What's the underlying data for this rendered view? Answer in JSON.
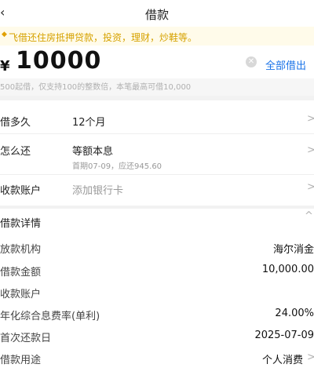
{
  "header": {
    "back_icon": "chevron-left-icon",
    "title": "借款"
  },
  "notice": {
    "text": "飞借还住房抵押贷款，投资，理财，炒鞋等。"
  },
  "amount": {
    "currency": "¥",
    "value": "10000",
    "borrow_all_label": "全部借出"
  },
  "hint": {
    "text": "500起借，仅支持100的整数倍，本笔最高可借10,000"
  },
  "form": {
    "term": {
      "label": "借多久",
      "value": "12个月"
    },
    "repay": {
      "label": "怎么还",
      "value": "等额本息",
      "sub": "首期07-09，应还945.60"
    },
    "account": {
      "label": "收款账户",
      "placeholder": "添加银行卡"
    }
  },
  "details": {
    "title": "借款详情",
    "rows": [
      {
        "label": "放款机构",
        "value": "海尔消金"
      },
      {
        "label": "借款金额",
        "value": "10,000.00"
      },
      {
        "label": "收款账户",
        "value": ""
      },
      {
        "label": "年化综合息费率(单利)",
        "value": "24.00%"
      },
      {
        "label": "首次还款日",
        "value": "2025-07-09"
      },
      {
        "label": "借款用途",
        "value": "个人消费"
      }
    ]
  },
  "colors": {
    "accent": "#1a73e8",
    "notice_text": "#d6a200",
    "notice_bg": "#fffbea"
  }
}
